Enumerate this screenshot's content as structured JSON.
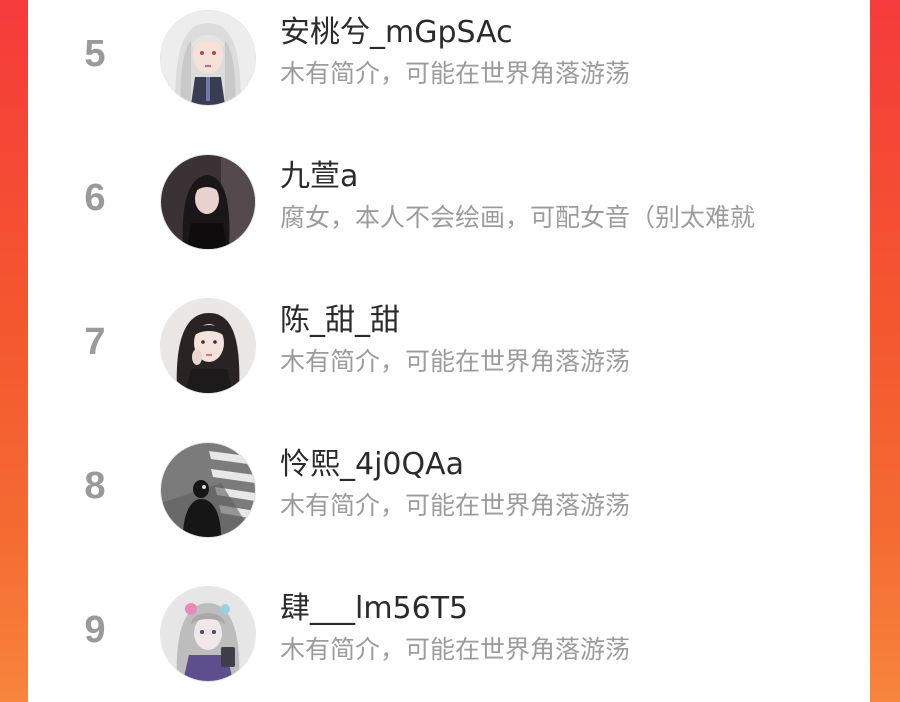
{
  "ranking_list": {
    "items": [
      {
        "rank": "5",
        "name": "安桃兮_mGpSAc",
        "bio": "木有简介，可能在世界角落游荡",
        "avatar_icon": "avatar-anime-girl-white-hair"
      },
      {
        "rank": "6",
        "name": "九萱a",
        "bio": "腐女，本人不会绘画，可配女音（别太难就",
        "avatar_icon": "avatar-girl-dark-hair"
      },
      {
        "rank": "7",
        "name": "陈_甜_甜",
        "bio": "木有简介，可能在世界角落游荡",
        "avatar_icon": "avatar-girl-portrait"
      },
      {
        "rank": "8",
        "name": "怜熙_4j0QAa",
        "bio": "木有简介，可能在世界角落游荡",
        "avatar_icon": "avatar-silhouette-crosswalk"
      },
      {
        "rank": "9",
        "name": "肆___lm56T5",
        "bio": "木有简介，可能在世界角落游荡",
        "avatar_icon": "avatar-anime-character-gray"
      }
    ]
  },
  "colors": {
    "background_gradient": [
      "#f53b3b",
      "#f7853c"
    ],
    "rank_number": "#9a9a9a",
    "name_text": "#2b2b2b",
    "bio_text": "#9c9c9c"
  }
}
